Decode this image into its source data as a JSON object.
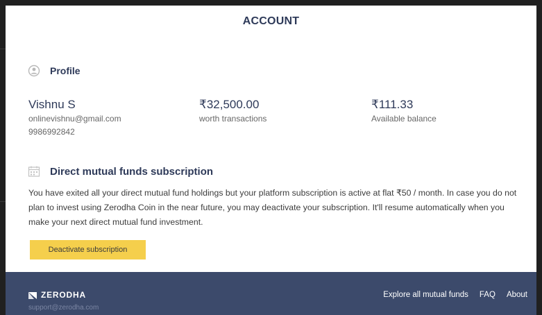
{
  "modal": {
    "title": "ACCOUNT"
  },
  "profile": {
    "heading": "Profile",
    "icon": "user-circle-icon",
    "name": "Vishnu S",
    "email": "onlinevishnu@gmail.com",
    "phone": "9986992842",
    "worth_value": "₹32,500.00",
    "worth_label": "worth transactions",
    "balance_value": "₹111.33",
    "balance_label": "Available balance"
  },
  "mutual_funds": {
    "heading": "Direct mutual funds subscription",
    "icon": "calendar-icon",
    "description": "You have exited all your direct mutual fund holdings but your platform subscription is active at flat ₹50 / month. In case you do not plan to invest using Zerodha Coin in the near future, you may deactivate your subscription. It'll resume automatically when you make your next direct mutual fund investment.",
    "button_label": "Deactivate subscription",
    "button_color": "#f5cf4c"
  },
  "footer": {
    "brand": "ZERODHA",
    "support_email": "support@zerodha.com",
    "links": [
      "Explore all mutual funds",
      "FAQ",
      "About"
    ],
    "background_color": "#3c4a6b"
  }
}
